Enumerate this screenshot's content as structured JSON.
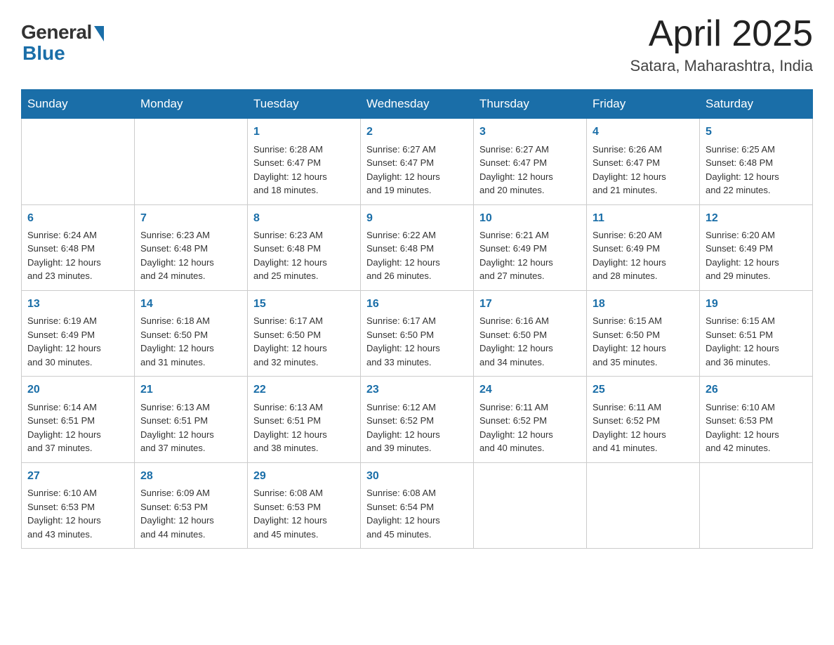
{
  "logo": {
    "general": "General",
    "blue": "Blue"
  },
  "header": {
    "month_year": "April 2025",
    "location": "Satara, Maharashtra, India"
  },
  "weekdays": [
    "Sunday",
    "Monday",
    "Tuesday",
    "Wednesday",
    "Thursday",
    "Friday",
    "Saturday"
  ],
  "weeks": [
    [
      {
        "day": "",
        "info": ""
      },
      {
        "day": "",
        "info": ""
      },
      {
        "day": "1",
        "info": "Sunrise: 6:28 AM\nSunset: 6:47 PM\nDaylight: 12 hours\nand 18 minutes."
      },
      {
        "day": "2",
        "info": "Sunrise: 6:27 AM\nSunset: 6:47 PM\nDaylight: 12 hours\nand 19 minutes."
      },
      {
        "day": "3",
        "info": "Sunrise: 6:27 AM\nSunset: 6:47 PM\nDaylight: 12 hours\nand 20 minutes."
      },
      {
        "day": "4",
        "info": "Sunrise: 6:26 AM\nSunset: 6:47 PM\nDaylight: 12 hours\nand 21 minutes."
      },
      {
        "day": "5",
        "info": "Sunrise: 6:25 AM\nSunset: 6:48 PM\nDaylight: 12 hours\nand 22 minutes."
      }
    ],
    [
      {
        "day": "6",
        "info": "Sunrise: 6:24 AM\nSunset: 6:48 PM\nDaylight: 12 hours\nand 23 minutes."
      },
      {
        "day": "7",
        "info": "Sunrise: 6:23 AM\nSunset: 6:48 PM\nDaylight: 12 hours\nand 24 minutes."
      },
      {
        "day": "8",
        "info": "Sunrise: 6:23 AM\nSunset: 6:48 PM\nDaylight: 12 hours\nand 25 minutes."
      },
      {
        "day": "9",
        "info": "Sunrise: 6:22 AM\nSunset: 6:48 PM\nDaylight: 12 hours\nand 26 minutes."
      },
      {
        "day": "10",
        "info": "Sunrise: 6:21 AM\nSunset: 6:49 PM\nDaylight: 12 hours\nand 27 minutes."
      },
      {
        "day": "11",
        "info": "Sunrise: 6:20 AM\nSunset: 6:49 PM\nDaylight: 12 hours\nand 28 minutes."
      },
      {
        "day": "12",
        "info": "Sunrise: 6:20 AM\nSunset: 6:49 PM\nDaylight: 12 hours\nand 29 minutes."
      }
    ],
    [
      {
        "day": "13",
        "info": "Sunrise: 6:19 AM\nSunset: 6:49 PM\nDaylight: 12 hours\nand 30 minutes."
      },
      {
        "day": "14",
        "info": "Sunrise: 6:18 AM\nSunset: 6:50 PM\nDaylight: 12 hours\nand 31 minutes."
      },
      {
        "day": "15",
        "info": "Sunrise: 6:17 AM\nSunset: 6:50 PM\nDaylight: 12 hours\nand 32 minutes."
      },
      {
        "day": "16",
        "info": "Sunrise: 6:17 AM\nSunset: 6:50 PM\nDaylight: 12 hours\nand 33 minutes."
      },
      {
        "day": "17",
        "info": "Sunrise: 6:16 AM\nSunset: 6:50 PM\nDaylight: 12 hours\nand 34 minutes."
      },
      {
        "day": "18",
        "info": "Sunrise: 6:15 AM\nSunset: 6:50 PM\nDaylight: 12 hours\nand 35 minutes."
      },
      {
        "day": "19",
        "info": "Sunrise: 6:15 AM\nSunset: 6:51 PM\nDaylight: 12 hours\nand 36 minutes."
      }
    ],
    [
      {
        "day": "20",
        "info": "Sunrise: 6:14 AM\nSunset: 6:51 PM\nDaylight: 12 hours\nand 37 minutes."
      },
      {
        "day": "21",
        "info": "Sunrise: 6:13 AM\nSunset: 6:51 PM\nDaylight: 12 hours\nand 37 minutes."
      },
      {
        "day": "22",
        "info": "Sunrise: 6:13 AM\nSunset: 6:51 PM\nDaylight: 12 hours\nand 38 minutes."
      },
      {
        "day": "23",
        "info": "Sunrise: 6:12 AM\nSunset: 6:52 PM\nDaylight: 12 hours\nand 39 minutes."
      },
      {
        "day": "24",
        "info": "Sunrise: 6:11 AM\nSunset: 6:52 PM\nDaylight: 12 hours\nand 40 minutes."
      },
      {
        "day": "25",
        "info": "Sunrise: 6:11 AM\nSunset: 6:52 PM\nDaylight: 12 hours\nand 41 minutes."
      },
      {
        "day": "26",
        "info": "Sunrise: 6:10 AM\nSunset: 6:53 PM\nDaylight: 12 hours\nand 42 minutes."
      }
    ],
    [
      {
        "day": "27",
        "info": "Sunrise: 6:10 AM\nSunset: 6:53 PM\nDaylight: 12 hours\nand 43 minutes."
      },
      {
        "day": "28",
        "info": "Sunrise: 6:09 AM\nSunset: 6:53 PM\nDaylight: 12 hours\nand 44 minutes."
      },
      {
        "day": "29",
        "info": "Sunrise: 6:08 AM\nSunset: 6:53 PM\nDaylight: 12 hours\nand 45 minutes."
      },
      {
        "day": "30",
        "info": "Sunrise: 6:08 AM\nSunset: 6:54 PM\nDaylight: 12 hours\nand 45 minutes."
      },
      {
        "day": "",
        "info": ""
      },
      {
        "day": "",
        "info": ""
      },
      {
        "day": "",
        "info": ""
      }
    ]
  ]
}
